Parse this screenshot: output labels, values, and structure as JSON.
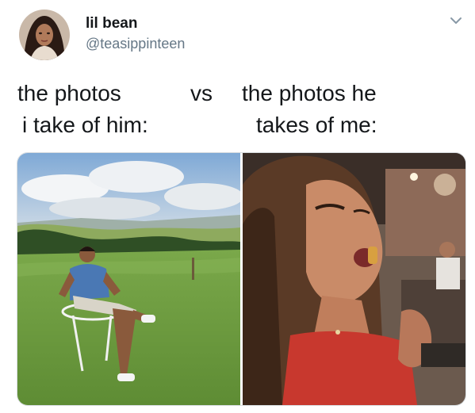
{
  "tweet": {
    "author": {
      "display_name": "lil bean",
      "handle": "@teasippinteen"
    },
    "menu_icon": "chevron-down-icon",
    "caption": {
      "left_line1": "the photos",
      "left_line2": "i take of him:",
      "vs": "vs",
      "right_line1": "the photos he",
      "right_line2": "takes of me:"
    },
    "colors": {
      "text": "#14171a",
      "secondary_text": "#657786",
      "chevron": "#8899a6"
    }
  }
}
